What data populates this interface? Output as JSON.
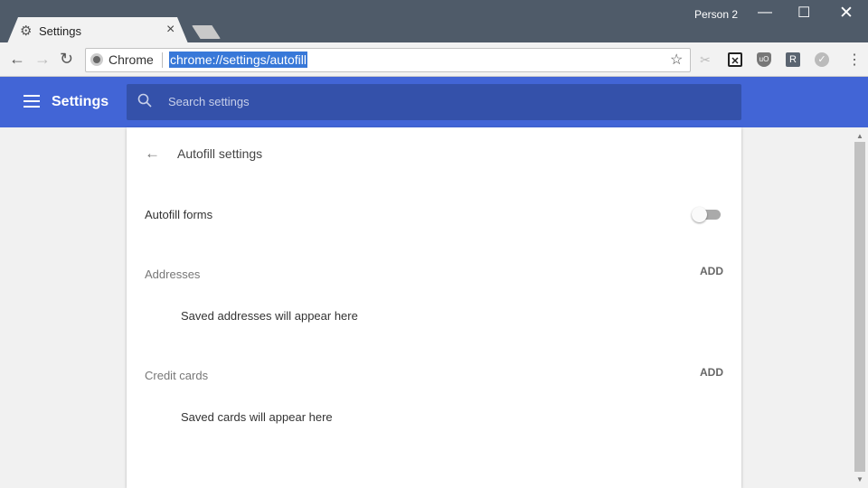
{
  "window": {
    "profile": "Person 2"
  },
  "tab": {
    "title": "Settings",
    "icon": "gear-icon"
  },
  "omnibox": {
    "site_label": "Chrome",
    "url": "chrome://settings/autofill"
  },
  "header": {
    "title": "Settings",
    "search_placeholder": "Search settings"
  },
  "page": {
    "title": "Autofill settings",
    "autofill_forms": {
      "label": "Autofill forms",
      "enabled": false
    },
    "addresses": {
      "heading": "Addresses",
      "add": "ADD",
      "empty": "Saved addresses will appear here"
    },
    "credit_cards": {
      "heading": "Credit cards",
      "add": "ADD",
      "empty": "Saved cards will appear here"
    }
  },
  "colors": {
    "header": "#4265d6",
    "search": "#3451aa",
    "titlebar": "#4f5b69",
    "selection": "#3878d8"
  }
}
